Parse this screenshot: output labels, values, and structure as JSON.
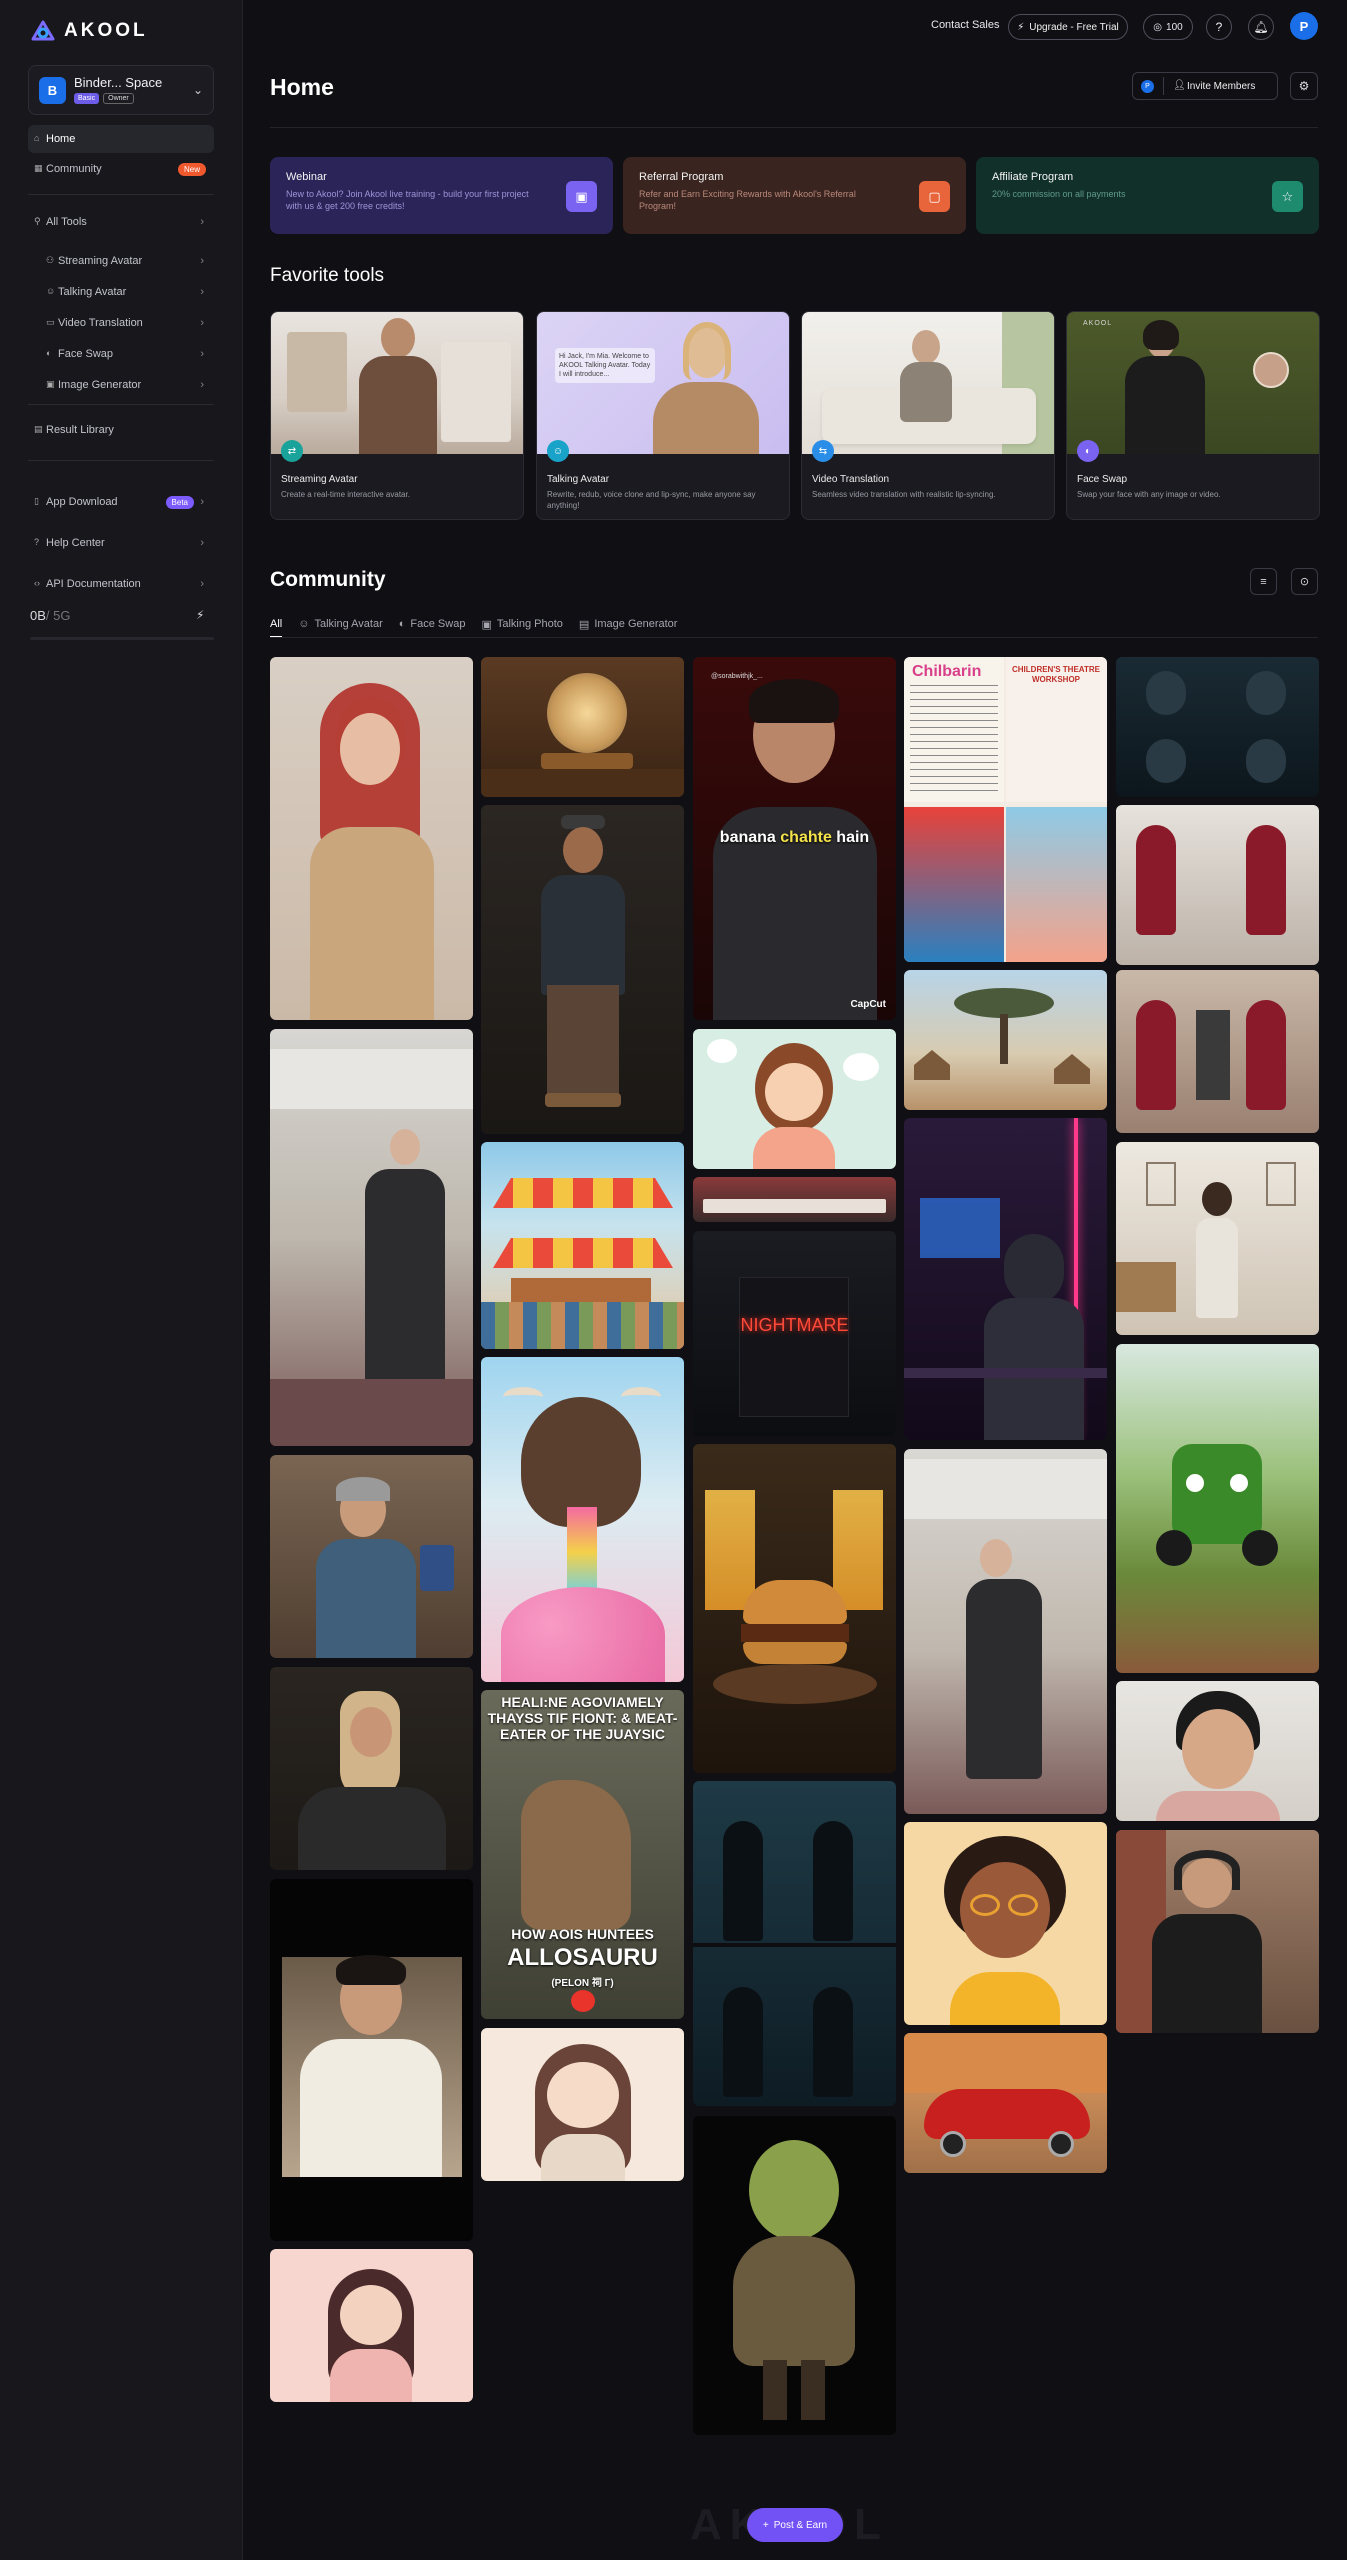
{
  "brand": {
    "name": "AKOOL"
  },
  "workspace": {
    "initial": "B",
    "name": "Binder... Space",
    "plan": "Basic",
    "role": "Owner"
  },
  "sidebar": {
    "home": "Home",
    "community": "Community",
    "community_badge": "New",
    "all_tools": "All Tools",
    "tools": [
      "Streaming Avatar",
      "Talking Avatar",
      "Video Translation",
      "Face Swap",
      "Image Generator"
    ],
    "result_library": "Result Library",
    "app_download": "App Download",
    "app_download_badge": "Beta",
    "help_center": "Help Center",
    "api_docs": "API Documentation",
    "storage_used": "0B",
    "storage_total": "/ 5G"
  },
  "topbar": {
    "contact_sales": "Contact Sales",
    "upgrade": "Upgrade - Free Trial",
    "credits": "100",
    "help": "?",
    "user_initial": "P"
  },
  "header": {
    "title": "Home",
    "invite": "Invite Members",
    "invite_avatar": "P"
  },
  "promos": [
    {
      "title": "Webinar",
      "desc": "New to Akool? Join Akool live training - build your first project with us & get 200 free credits!",
      "bg": "#2a2458",
      "desc_color": "#9d95d8",
      "icon_bg": "#7a63f0",
      "icon": "▣"
    },
    {
      "title": "Referral Program",
      "desc": "Refer and Earn Exciting Rewards with Akool's Referral Program!",
      "bg": "#3a2420",
      "desc_color": "#b9897a",
      "icon_bg": "#e8643a",
      "icon": "▢"
    },
    {
      "title": "Affiliate Program",
      "desc": "20% commission on all payments",
      "bg": "#12302a",
      "desc_color": "#5f9a89",
      "icon_bg": "#1e8a6e",
      "icon": "☆"
    }
  ],
  "favorite_tools_title": "Favorite tools",
  "favorite_tools": [
    {
      "name": "Streaming Avatar",
      "desc": "Create a real-time interactive avatar.",
      "badge_bg": "#1aa39a",
      "badge_icon": "⇄"
    },
    {
      "name": "Talking Avatar",
      "desc": "Rewrite, redub, voice clone and lip-sync, make anyone say anything!",
      "badge_bg": "#1aa3c8",
      "badge_icon": "☺"
    },
    {
      "name": "Video Translation",
      "desc": "Seamless video translation with realistic lip-syncing.",
      "badge_bg": "#2a8ee8",
      "badge_icon": "⇆"
    },
    {
      "name": "Face Swap",
      "desc": "Swap your face with any image or video.",
      "badge_bg": "#7a63f0",
      "badge_icon": "◐"
    }
  ],
  "talking_avatar_bubble": "Hi Jack, I'm Mia. Welcome to AKOOL Talking Avatar. Today I will introduce...",
  "face_swap_brand": "AKOOL",
  "community": {
    "title": "Community",
    "tabs": [
      "All",
      "Talking Avatar",
      "Face Swap",
      "Talking Photo",
      "Image Generator"
    ]
  },
  "tile_captions": {
    "banana_line1": "banana",
    "banana_highlight": "chahte",
    "banana_line2": "hain",
    "capcut": "CapCut",
    "handle": "@sorabwithjk_...",
    "nightmare": "NIGHTMARE",
    "dino_top": "HEALI:NE AGOVIAMELY THAYSS TIF FIONT: & MEAT-EATER OF THE JUAYSIC",
    "dino_bottom1": "HOW AOIS HUNTEES",
    "dino_bottom2": "ALLOSAURU",
    "dino_bottom3": "(PELON 祠 Г)",
    "flyer_left": "Chilbarin",
    "flyer_right": "CHILDREN'S THEATRE WORKSHOP"
  },
  "post_button": "Post & Earn",
  "watermark": "AKOOL"
}
